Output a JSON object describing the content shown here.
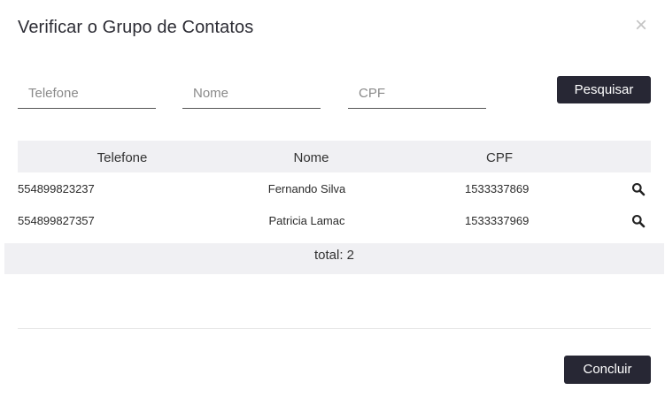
{
  "modal": {
    "title": "Verificar o Grupo de Contatos",
    "close_symbol": "×"
  },
  "filters": {
    "telefone_placeholder": "Telefone",
    "nome_placeholder": "Nome",
    "cpf_placeholder": "CPF",
    "search_label": "Pesquisar"
  },
  "table": {
    "columns": [
      "Telefone",
      "Nome",
      "CPF"
    ],
    "rows": [
      {
        "telefone": "554899823237",
        "nome": "Fernando Silva",
        "cpf": "1533337869",
        "action_icon": "search-icon"
      },
      {
        "telefone": "554899827357",
        "nome": "Patricia Lamac",
        "cpf": "1533337969",
        "action_icon": "search-icon"
      }
    ],
    "total_label": "total: 2"
  },
  "actions": {
    "done_label": "Concluir"
  },
  "colors": {
    "button_bg": "#272734",
    "header_bg": "#f0f0f3"
  }
}
